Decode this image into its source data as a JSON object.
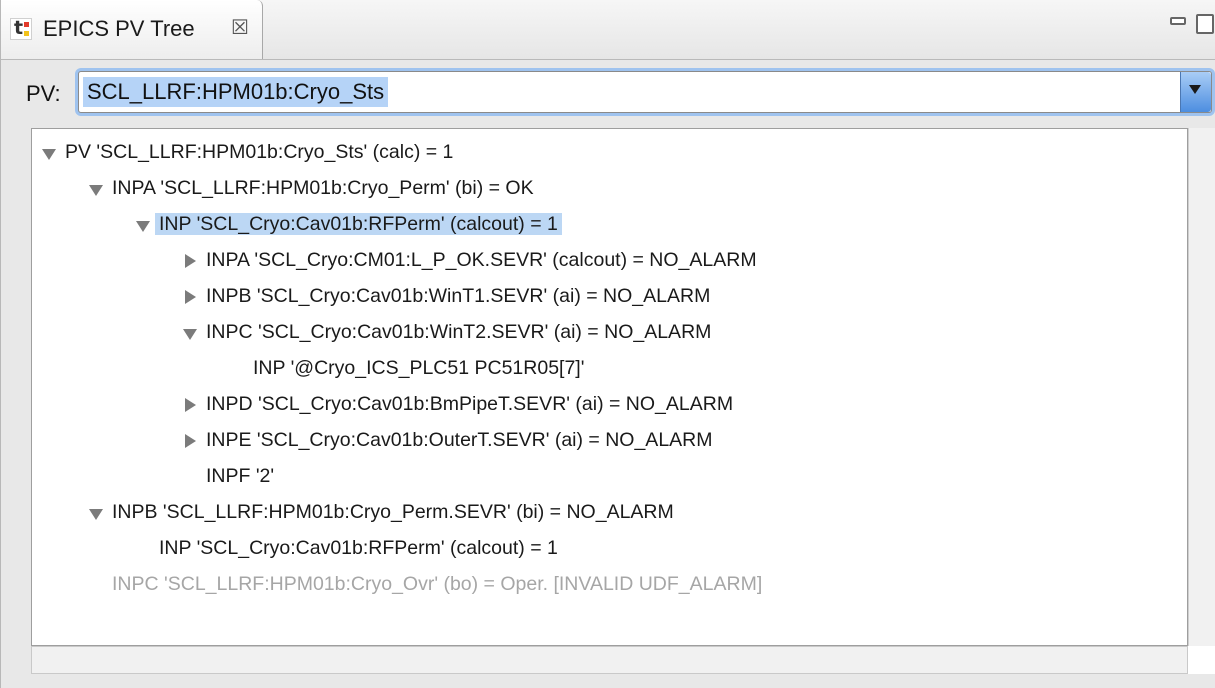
{
  "view": {
    "tab_title": "EPICS PV Tree",
    "tab_close_glyph": "☒",
    "tab_icon": "epics-tree-icon"
  },
  "pv": {
    "label": "PV:",
    "value": "SCL_LLRF:HPM01b:Cryo_Sts"
  },
  "tree": [
    {
      "text": "PV 'SCL_LLRF:HPM01b:Cryo_Sts'  (calc)  =  1",
      "level": 0,
      "toggle": "open"
    },
    {
      "text": "INPA 'SCL_LLRF:HPM01b:Cryo_Perm'  (bi)  =  OK",
      "level": 1,
      "toggle": "open"
    },
    {
      "text": "INP 'SCL_Cryo:Cav01b:RFPerm'  (calcout)  =  1",
      "level": 2,
      "toggle": "open",
      "selected": true
    },
    {
      "text": "INPA 'SCL_Cryo:CM01:L_P_OK.SEVR'  (calcout)  =  NO_ALARM",
      "level": 3,
      "toggle": "closed"
    },
    {
      "text": "INPB 'SCL_Cryo:Cav01b:WinT1.SEVR'  (ai)  =  NO_ALARM",
      "level": 3,
      "toggle": "closed"
    },
    {
      "text": "INPC 'SCL_Cryo:Cav01b:WinT2.SEVR'  (ai)  =  NO_ALARM",
      "level": 3,
      "toggle": "open"
    },
    {
      "text": "INP '@Cryo_ICS_PLC51 PC51R05[7]'",
      "level": 4,
      "toggle": "none"
    },
    {
      "text": "INPD 'SCL_Cryo:Cav01b:BmPipeT.SEVR'  (ai)  =  NO_ALARM",
      "level": 3,
      "toggle": "closed"
    },
    {
      "text": "INPE 'SCL_Cryo:Cav01b:OuterT.SEVR'  (ai)  =  NO_ALARM",
      "level": 3,
      "toggle": "closed"
    },
    {
      "text": "INPF '2'",
      "level": 3,
      "toggle": "none"
    },
    {
      "text": "INPB 'SCL_LLRF:HPM01b:Cryo_Perm.SEVR'  (bi)  =  NO_ALARM",
      "level": 1,
      "toggle": "open"
    },
    {
      "text": "INP 'SCL_Cryo:Cav01b:RFPerm'  (calcout)  =  1",
      "level": 2,
      "toggle": "none"
    },
    {
      "text": "INPC 'SCL_LLRF:HPM01b:Cryo_Ovr'  (bo)  =  Oper. [INVALID UDF_ALARM]",
      "level": 1,
      "toggle": "none",
      "dim": true
    }
  ]
}
